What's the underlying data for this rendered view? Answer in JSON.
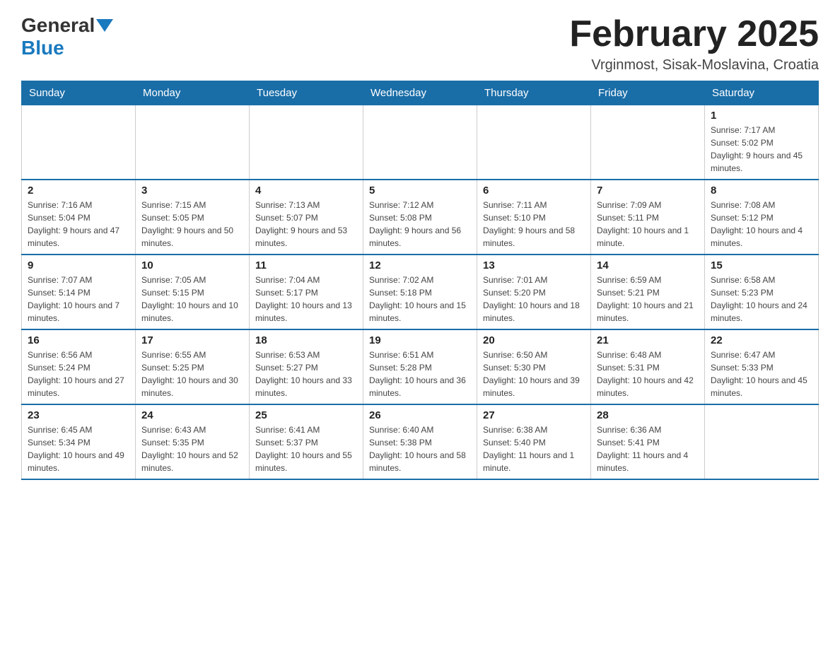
{
  "header": {
    "logo_general": "General",
    "logo_blue": "Blue",
    "month_title": "February 2025",
    "location": "Vrginmost, Sisak-Moslavina, Croatia"
  },
  "weekdays": [
    "Sunday",
    "Monday",
    "Tuesday",
    "Wednesday",
    "Thursday",
    "Friday",
    "Saturday"
  ],
  "weeks": [
    [
      {
        "day": "",
        "info": ""
      },
      {
        "day": "",
        "info": ""
      },
      {
        "day": "",
        "info": ""
      },
      {
        "day": "",
        "info": ""
      },
      {
        "day": "",
        "info": ""
      },
      {
        "day": "",
        "info": ""
      },
      {
        "day": "1",
        "info": "Sunrise: 7:17 AM\nSunset: 5:02 PM\nDaylight: 9 hours and 45 minutes."
      }
    ],
    [
      {
        "day": "2",
        "info": "Sunrise: 7:16 AM\nSunset: 5:04 PM\nDaylight: 9 hours and 47 minutes."
      },
      {
        "day": "3",
        "info": "Sunrise: 7:15 AM\nSunset: 5:05 PM\nDaylight: 9 hours and 50 minutes."
      },
      {
        "day": "4",
        "info": "Sunrise: 7:13 AM\nSunset: 5:07 PM\nDaylight: 9 hours and 53 minutes."
      },
      {
        "day": "5",
        "info": "Sunrise: 7:12 AM\nSunset: 5:08 PM\nDaylight: 9 hours and 56 minutes."
      },
      {
        "day": "6",
        "info": "Sunrise: 7:11 AM\nSunset: 5:10 PM\nDaylight: 9 hours and 58 minutes."
      },
      {
        "day": "7",
        "info": "Sunrise: 7:09 AM\nSunset: 5:11 PM\nDaylight: 10 hours and 1 minute."
      },
      {
        "day": "8",
        "info": "Sunrise: 7:08 AM\nSunset: 5:12 PM\nDaylight: 10 hours and 4 minutes."
      }
    ],
    [
      {
        "day": "9",
        "info": "Sunrise: 7:07 AM\nSunset: 5:14 PM\nDaylight: 10 hours and 7 minutes."
      },
      {
        "day": "10",
        "info": "Sunrise: 7:05 AM\nSunset: 5:15 PM\nDaylight: 10 hours and 10 minutes."
      },
      {
        "day": "11",
        "info": "Sunrise: 7:04 AM\nSunset: 5:17 PM\nDaylight: 10 hours and 13 minutes."
      },
      {
        "day": "12",
        "info": "Sunrise: 7:02 AM\nSunset: 5:18 PM\nDaylight: 10 hours and 15 minutes."
      },
      {
        "day": "13",
        "info": "Sunrise: 7:01 AM\nSunset: 5:20 PM\nDaylight: 10 hours and 18 minutes."
      },
      {
        "day": "14",
        "info": "Sunrise: 6:59 AM\nSunset: 5:21 PM\nDaylight: 10 hours and 21 minutes."
      },
      {
        "day": "15",
        "info": "Sunrise: 6:58 AM\nSunset: 5:23 PM\nDaylight: 10 hours and 24 minutes."
      }
    ],
    [
      {
        "day": "16",
        "info": "Sunrise: 6:56 AM\nSunset: 5:24 PM\nDaylight: 10 hours and 27 minutes."
      },
      {
        "day": "17",
        "info": "Sunrise: 6:55 AM\nSunset: 5:25 PM\nDaylight: 10 hours and 30 minutes."
      },
      {
        "day": "18",
        "info": "Sunrise: 6:53 AM\nSunset: 5:27 PM\nDaylight: 10 hours and 33 minutes."
      },
      {
        "day": "19",
        "info": "Sunrise: 6:51 AM\nSunset: 5:28 PM\nDaylight: 10 hours and 36 minutes."
      },
      {
        "day": "20",
        "info": "Sunrise: 6:50 AM\nSunset: 5:30 PM\nDaylight: 10 hours and 39 minutes."
      },
      {
        "day": "21",
        "info": "Sunrise: 6:48 AM\nSunset: 5:31 PM\nDaylight: 10 hours and 42 minutes."
      },
      {
        "day": "22",
        "info": "Sunrise: 6:47 AM\nSunset: 5:33 PM\nDaylight: 10 hours and 45 minutes."
      }
    ],
    [
      {
        "day": "23",
        "info": "Sunrise: 6:45 AM\nSunset: 5:34 PM\nDaylight: 10 hours and 49 minutes."
      },
      {
        "day": "24",
        "info": "Sunrise: 6:43 AM\nSunset: 5:35 PM\nDaylight: 10 hours and 52 minutes."
      },
      {
        "day": "25",
        "info": "Sunrise: 6:41 AM\nSunset: 5:37 PM\nDaylight: 10 hours and 55 minutes."
      },
      {
        "day": "26",
        "info": "Sunrise: 6:40 AM\nSunset: 5:38 PM\nDaylight: 10 hours and 58 minutes."
      },
      {
        "day": "27",
        "info": "Sunrise: 6:38 AM\nSunset: 5:40 PM\nDaylight: 11 hours and 1 minute."
      },
      {
        "day": "28",
        "info": "Sunrise: 6:36 AM\nSunset: 5:41 PM\nDaylight: 11 hours and 4 minutes."
      },
      {
        "day": "",
        "info": ""
      }
    ]
  ]
}
